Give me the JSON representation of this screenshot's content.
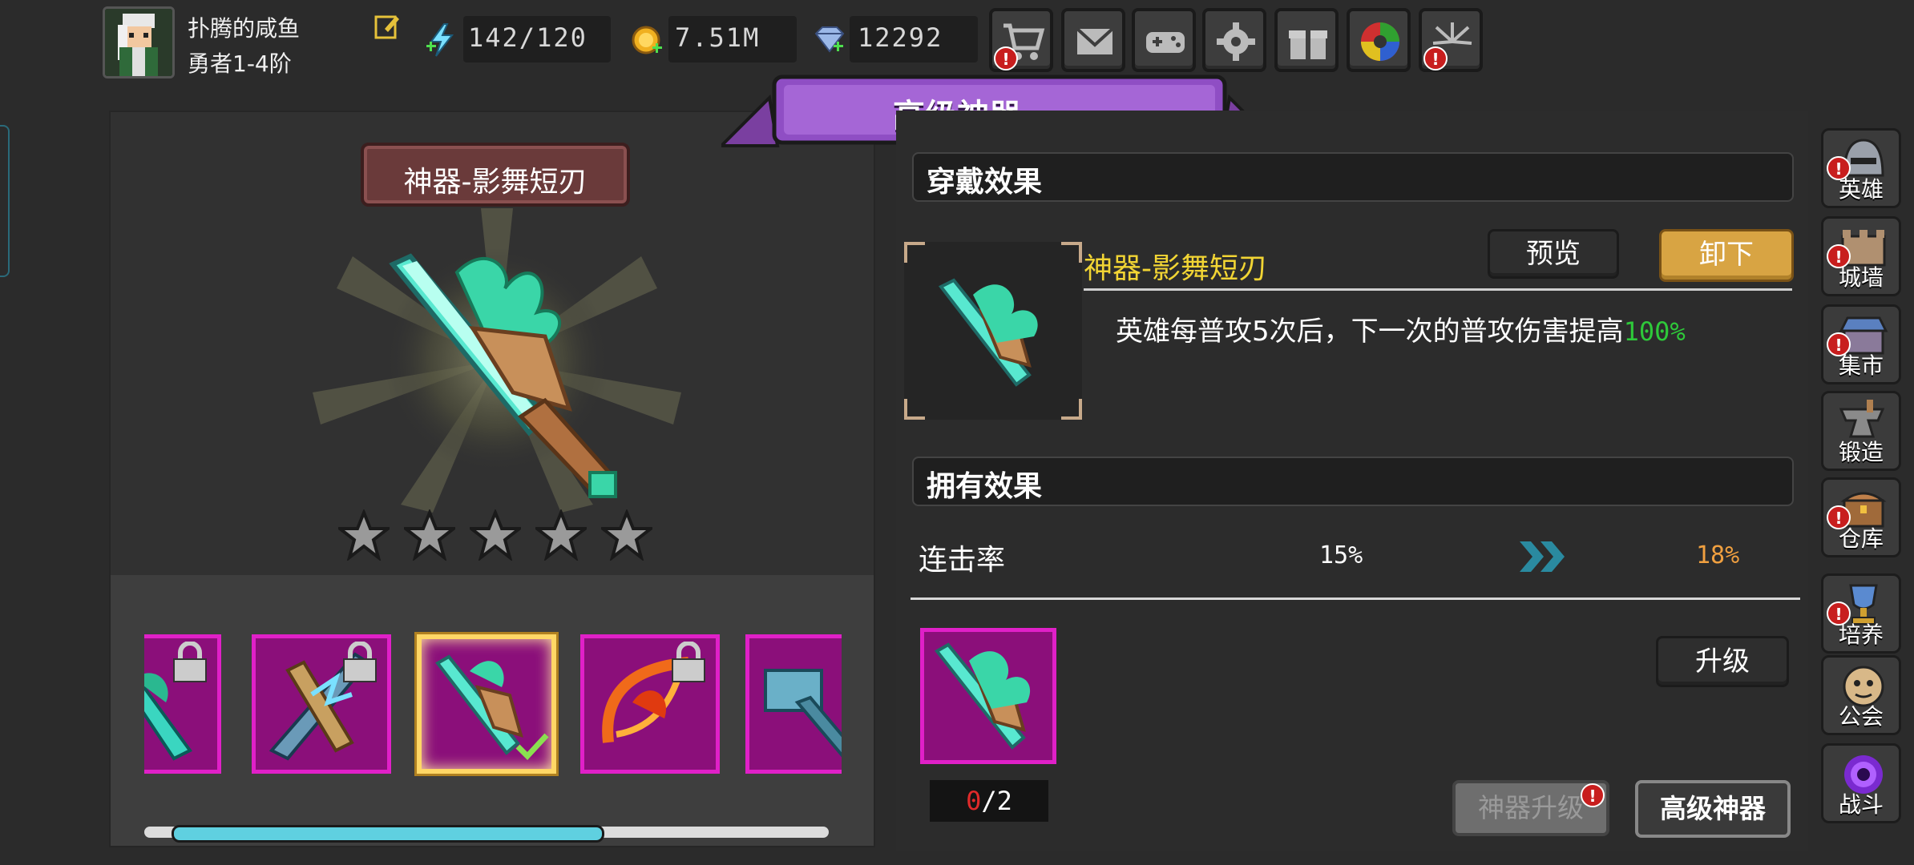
{
  "player": {
    "name": "扑腾的咸鱼",
    "rank": "勇者1-4阶"
  },
  "resources": {
    "energy": "142/120",
    "gold": "7.51M",
    "gems": "12292"
  },
  "top_buttons": [
    "shop-icon",
    "mail-icon",
    "gamepad-icon",
    "settings-icon",
    "gift-icon",
    "camera-shutter-icon",
    "fireworks-icon"
  ],
  "banner": "高级神器",
  "artifact": {
    "plate_title": "神器-影舞短刃",
    "stars": 5
  },
  "wear_effect": {
    "header": "穿戴效果",
    "name": "神器-影舞短刃",
    "preview_label": "预览",
    "unequip_label": "卸下",
    "description": "英雄每普攻5次后，下一次的普攻伤害提高",
    "description_value": "100%"
  },
  "own_effect": {
    "header": "拥有效果",
    "stat_label": "连击率",
    "stat_current": "15%",
    "stat_next": "18%"
  },
  "upgrade": {
    "material_have": "0",
    "material_need": "/2",
    "upgrade_label": "升级",
    "artifact_upgrade_label": "神器升级",
    "advanced_label": "高级神器"
  },
  "carousel": {
    "scroll_position": 0.1,
    "visible_fraction": 0.63
  },
  "sidebar": [
    {
      "label": "英雄",
      "icon": "helmet-icon",
      "alert": true
    },
    {
      "label": "城墙",
      "icon": "wall-icon",
      "alert": true
    },
    {
      "label": "集市",
      "icon": "market-icon",
      "alert": true
    },
    {
      "label": "锻造",
      "icon": "anvil-icon",
      "alert": false
    },
    {
      "label": "仓库",
      "icon": "chest-icon",
      "alert": true
    },
    {
      "label": "培养",
      "icon": "trophy-icon",
      "alert": true
    },
    {
      "label": "公会",
      "icon": "guild-icon",
      "alert": false
    },
    {
      "label": "战斗",
      "icon": "portal-icon",
      "alert": false
    }
  ],
  "colors": {
    "accent_gold": "#d8a443",
    "item_name": "#f2d534",
    "increase": "#2ec93a",
    "next_value": "#f0a040",
    "slot_magenta": "#8b0f7a"
  }
}
